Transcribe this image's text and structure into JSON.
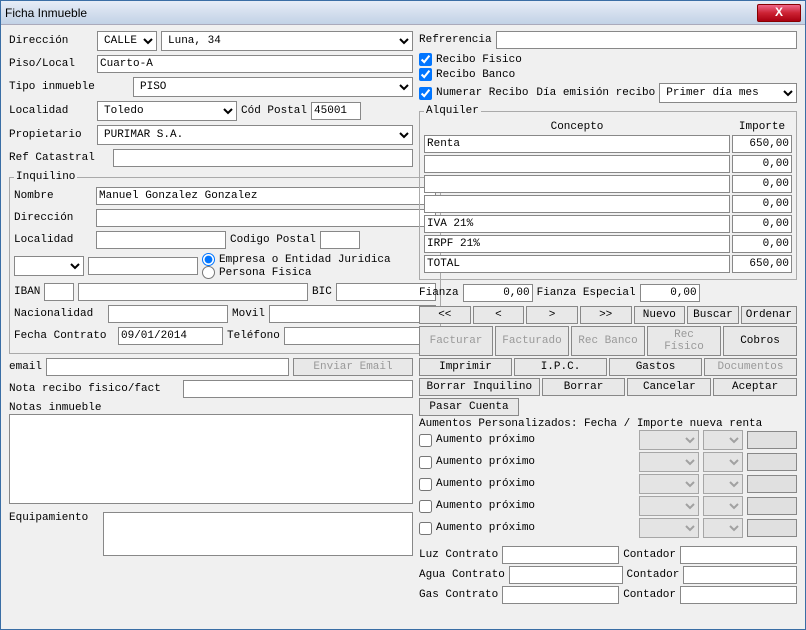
{
  "window": {
    "title": "Ficha Inmueble",
    "close": "X"
  },
  "left": {
    "direccion_label": "Dirección",
    "direccion_type": "CALLE",
    "direccion_value": "Luna, 34",
    "piso_label": "Piso/Local",
    "piso_value": "Cuarto-A",
    "tipo_label": "Tipo inmueble",
    "tipo_value": "PISO",
    "localidad_label": "Localidad",
    "localidad_value": "Toledo",
    "cp_label": "Cód Postal",
    "cp_value": "45001",
    "propietario_label": "Propietario",
    "propietario_value": "PURIMAR S.A.",
    "ref_catastral_label": "Ref Catastral",
    "ref_catastral_value": ""
  },
  "inquilino": {
    "legend": "Inquilino",
    "nombre_label": "Nombre",
    "nombre_value": "Manuel Gonzalez Gonzalez",
    "direccion_label": "Dirección",
    "direccion_value": "",
    "localidad_label": "Localidad",
    "localidad_value": "",
    "cp_label": "Codigo Postal",
    "cp_value": "",
    "radio_empresa": "Empresa o Entidad Juridica",
    "radio_persona": "Persona Fisica",
    "iban_label": "IBAN",
    "iban_value": "",
    "bic_label": "BIC",
    "bic_value": "",
    "nacionalidad_label": "Nacionalidad",
    "nacionalidad_value": "",
    "movil_label": "Movil",
    "movil_value": "",
    "fecha_label": "Fecha Contrato",
    "fecha_value": "09/01/2014",
    "telefono_label": "Teléfono",
    "telefono_value": "",
    "email_label": "email",
    "email_value": "",
    "enviar_email": "Enviar Email"
  },
  "notas": {
    "nota_recibo_label": "Nota recibo fisico/fact",
    "nota_recibo_value": "",
    "notas_inmueble_label": "Notas inmueble",
    "notas_inmueble_value": "",
    "equipamiento_label": "Equipamiento",
    "equipamiento_value": ""
  },
  "right": {
    "referencia_label": "Refrerencia",
    "referencia_value": "",
    "recibo_fisico": "Recibo Fisico",
    "recibo_banco": "Recibo Banco",
    "numerar_recibo": "Numerar Recibo",
    "dia_emision_label": "Día emisión recibo",
    "dia_emision_value": "Primer día mes"
  },
  "alquiler": {
    "legend": "Alquiler",
    "concepto_header": "Concepto",
    "importe_header": "Importe",
    "lines": [
      {
        "concepto": "Renta",
        "importe": "650,00"
      },
      {
        "concepto": "",
        "importe": "0,00"
      },
      {
        "concepto": "",
        "importe": "0,00"
      },
      {
        "concepto": "",
        "importe": "0,00"
      },
      {
        "concepto": "IVA 21%",
        "importe": "0,00"
      },
      {
        "concepto": "IRPF 21%",
        "importe": "0,00"
      },
      {
        "concepto": "TOTAL",
        "importe": "650,00"
      }
    ],
    "fianza_label": "Fianza",
    "fianza_value": "0,00",
    "fianza_especial_label": "Fianza Especial",
    "fianza_especial_value": "0,00"
  },
  "buttons": {
    "first": "<<",
    "prev": "<",
    "next": ">",
    "last": ">>",
    "nuevo": "Nuevo",
    "buscar": "Buscar",
    "ordenar": "Ordenar",
    "facturar": "Facturar",
    "facturado": "Facturado",
    "rec_banco": "Rec Banco",
    "rec_fisico": "Rec Físico",
    "cobros": "Cobros",
    "imprimir": "Imprimir",
    "ipc": "I.P.C.",
    "gastos": "Gastos",
    "documentos": "Documentos",
    "borrar_inquilino": "Borrar Inquilino",
    "borrar": "Borrar",
    "cancelar": "Cancelar",
    "aceptar": "Aceptar",
    "pasar_cuenta": "Pasar Cuenta"
  },
  "aumentos": {
    "header": "Aumentos Personalizados:  Fecha / Importe nueva renta",
    "row_label": "Aumento próximo"
  },
  "utilidades": {
    "luz_contrato": "Luz  Contrato",
    "agua_contrato": "Agua Contrato",
    "gas_contrato": "Gas  Contrato",
    "contador": "Contador"
  }
}
